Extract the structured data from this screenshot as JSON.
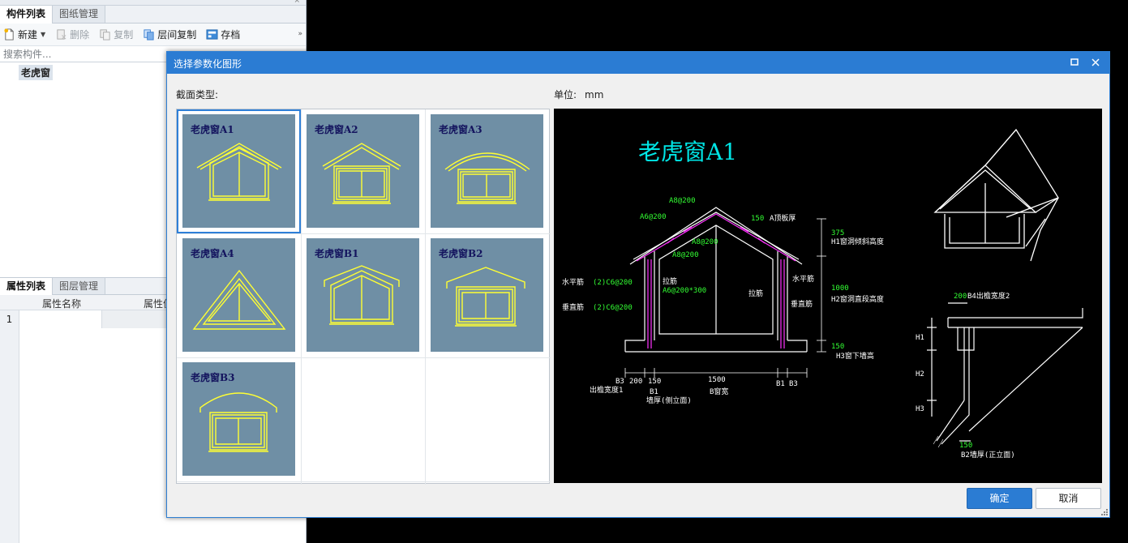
{
  "left_panel": {
    "close_glyph": "×",
    "tabs": [
      "构件列表",
      "图纸管理"
    ],
    "toolbar": {
      "new": "新建",
      "delete": "删除",
      "copy": "复制",
      "floor_copy": "层间复制",
      "archive": "存档",
      "more": "»"
    },
    "search_placeholder": "搜索构件...",
    "tree_item": "老虎窗",
    "tabs2": [
      "属性列表",
      "图层管理"
    ],
    "grid": {
      "col_name": "属性名称",
      "col_value": "属性值",
      "row1_num": "1"
    }
  },
  "dialog": {
    "title": "选择参数化图形",
    "section_label": "截面类型:",
    "unit_label": "单位:",
    "unit_value": "mm",
    "shapes": [
      {
        "name": "老虎窗A1",
        "selected": true
      },
      {
        "name": "老虎窗A2"
      },
      {
        "name": "老虎窗A3"
      },
      {
        "name": "老虎窗A4"
      },
      {
        "name": "老虎窗B1"
      },
      {
        "name": "老虎窗B2"
      },
      {
        "name": "老虎窗B3"
      }
    ],
    "ok_label": "确定",
    "cancel_label": "取消",
    "preview": {
      "title": "老虎窗A1",
      "labels": {
        "a8_top": "A8@200",
        "a6_left": "A6@200",
        "top_thk_val": "150",
        "top_thk_name": "A顶板厚",
        "a8_mid": "A8@200",
        "a8_lower": "A8@200",
        "h1_val": "375",
        "h1_name": "H1窗洞倾斜高度",
        "horiz_bar_l": "水平筋",
        "horiz_bar_l_spec": "(2)C6@200",
        "tie_bar_l": "拉筋",
        "tie_spec": "A6@200*300",
        "tie_bar_r": "拉筋",
        "horiz_bar_r": "水平筋",
        "vert_bar_l": "垂直筋",
        "vert_bar_l_spec": "(2)C6@200",
        "vert_bar_r": "垂直筋",
        "h2_val": "1000",
        "h2_name": "H2窗洞直段高度",
        "h3_val": "150",
        "h3_name": "H3窗下墙高",
        "b3": "B3",
        "b3_r": "B3",
        "dim_200": "200",
        "dim_150": "150",
        "dim_1500": "1500",
        "b1": "B1",
        "b1_r": "B1",
        "eave1": "出檐宽度1",
        "b1_lower": "B1",
        "wall_side": "墙厚(侧立面)",
        "b_window": "B窗宽",
        "b4_val": "200",
        "b4_name": "B4出檐宽度2",
        "h1": "H1",
        "h2": "H2",
        "h3": "H3",
        "b2_val": "150",
        "b2_name": "B2墙厚(正立面)"
      }
    }
  },
  "colors": {
    "title_bar": "#2b7cd3",
    "thumb_bg": "#6f8fa5",
    "thumb_line": "#ffff33",
    "preview_title": "#00e5e5",
    "preview_dims": "#33ff33",
    "preview_rebar": "#ff33ff"
  }
}
